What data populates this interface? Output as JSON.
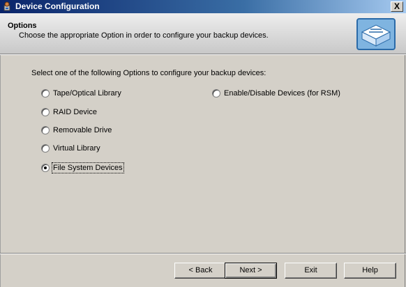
{
  "window": {
    "title": "Device Configuration",
    "close_label": "X"
  },
  "header": {
    "title": "Options",
    "subtitle": "Choose the appropriate Option in order to configure your backup devices."
  },
  "prompt": "Select one of the following Options to configure your backup devices:",
  "options": [
    {
      "label": "Tape/Optical Library",
      "checked": false
    },
    {
      "label": "RAID Device",
      "checked": false
    },
    {
      "label": "Removable Drive",
      "checked": false
    },
    {
      "label": "Virtual Library",
      "checked": false
    },
    {
      "label": "File System Devices",
      "checked": true
    },
    {
      "label": "Enable/Disable Devices (for RSM)",
      "checked": false
    }
  ],
  "buttons": {
    "back": "< Back",
    "next": "Next >",
    "exit": "Exit",
    "help": "Help"
  }
}
